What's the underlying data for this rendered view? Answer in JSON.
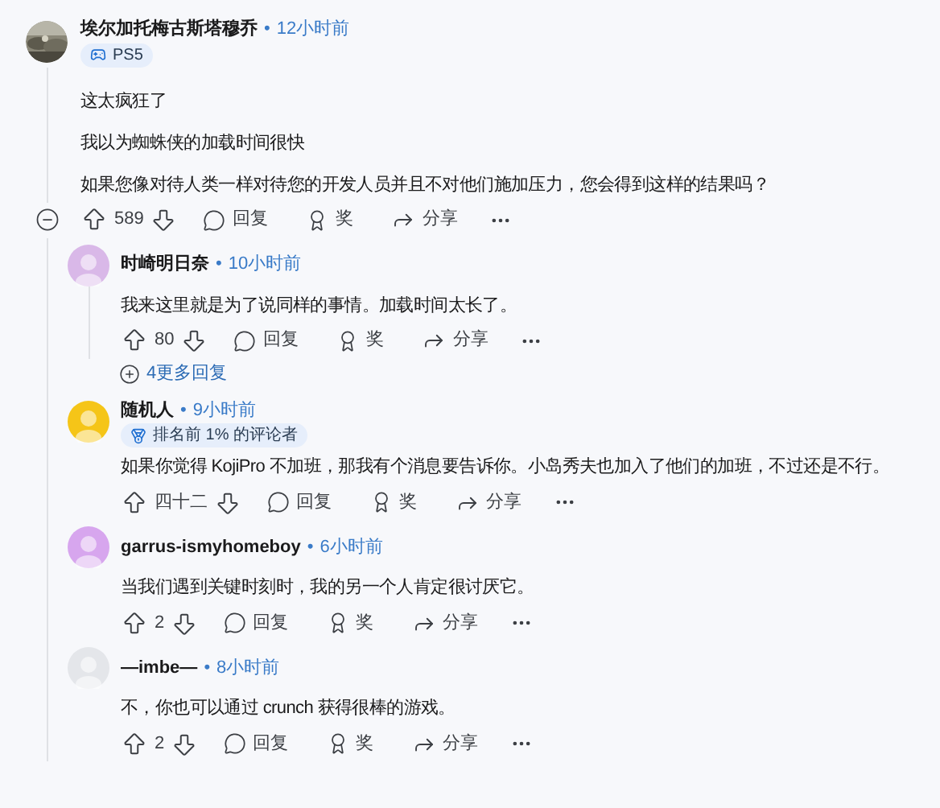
{
  "comment": {
    "author": "埃尔加托梅古斯塔穆乔",
    "separator": "•",
    "time": "12小时前",
    "avatar": {
      "kind": "picture"
    },
    "flair": {
      "kind": "console",
      "text": "PS5"
    },
    "body": [
      "这太疯狂了",
      "我以为蜘蛛侠的加载时间很快",
      "如果您像对待人类一样对待您的开发人员并且不对他们施加压力，您会得到这样的结果吗？"
    ],
    "votes": "589",
    "actions": {
      "reply": "回复",
      "award": "奖",
      "share": "分享"
    },
    "replies": [
      {
        "author": "时崎明日奈",
        "separator": "•",
        "time": "10小时前",
        "avatar": {
          "kind": "silhouette",
          "color": "#d9b8e8"
        },
        "body": [
          "我来这里就是为了说同样的事情。加载时间太长了。"
        ],
        "votes": "80",
        "actions": {
          "reply": "回复",
          "award": "奖",
          "share": "分享"
        },
        "more_replies": "4更多回复"
      },
      {
        "author": "随机人",
        "separator": "•",
        "time": "9小时前",
        "avatar": {
          "kind": "silhouette",
          "color": "#f5c518"
        },
        "flair": {
          "kind": "rank",
          "text": "排名前 1% 的评论者"
        },
        "body": [
          "如果你觉得 KojiPro 不加班，那我有个消息要告诉你。小岛秀夫也加入了他们的加班，不过还是不行。"
        ],
        "votes": "四十二",
        "actions": {
          "reply": "回复",
          "award": "奖",
          "share": "分享"
        }
      },
      {
        "author": "garrus-ismyhomeboy",
        "separator": "•",
        "time": "6小时前",
        "avatar": {
          "kind": "silhouette",
          "color": "#d7a6ee"
        },
        "body": [
          "当我们遇到关键时刻时，我的另一个人肯定很讨厌它。"
        ],
        "votes": "2",
        "actions": {
          "reply": "回复",
          "award": "奖",
          "share": "分享"
        }
      },
      {
        "author": "—imbe—",
        "separator": "•",
        "time": "8小时前",
        "avatar": {
          "kind": "silhouette",
          "color": "#e4e6ea"
        },
        "body": [
          "不，你也可以通过 crunch 获得很棒的游戏。"
        ],
        "votes": "2",
        "actions": {
          "reply": "回复",
          "award": "奖",
          "share": "分享"
        }
      }
    ]
  }
}
